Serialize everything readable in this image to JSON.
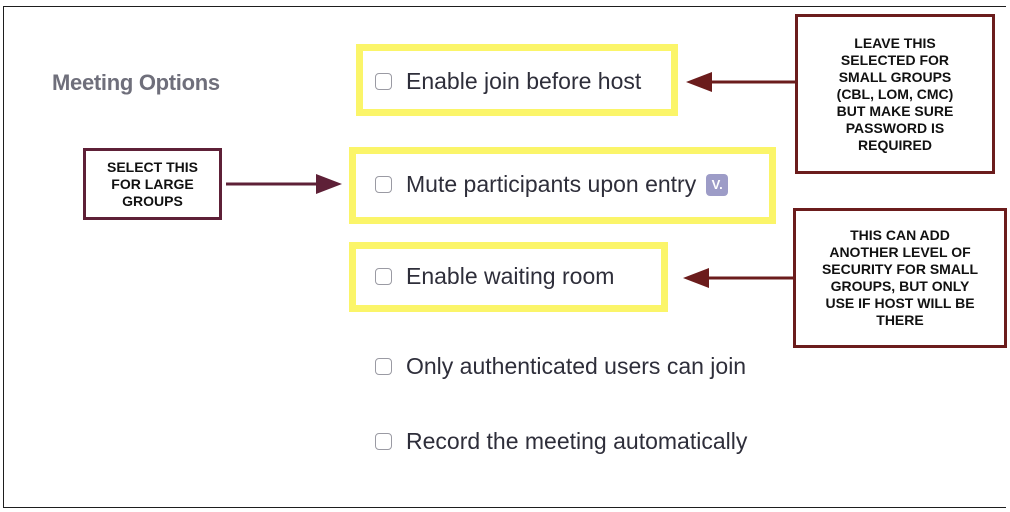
{
  "section": {
    "label": "Meeting Options"
  },
  "options": [
    {
      "label": "Enable join before host",
      "checked": false
    },
    {
      "label": "Mute participants upon entry",
      "checked": false,
      "icon": "info-icon",
      "icon_text": "V."
    },
    {
      "label": "Enable waiting room",
      "checked": false
    },
    {
      "label": "Only authenticated users can join",
      "checked": false
    },
    {
      "label": "Record the meeting automatically",
      "checked": false
    }
  ],
  "callouts": {
    "join_before_host": "LEAVE THIS\nSELECTED FOR\nSMALL GROUPS\n(CBL, LOM, CMC)\nBUT MAKE SURE\nPASSWORD IS\nREQUIRED",
    "mute_participants": "SELECT THIS\nFOR LARGE\nGROUPS",
    "waiting_room": "THIS CAN ADD\nANOTHER LEVEL OF\nSECURITY FOR SMALL\nGROUPS, BUT ONLY\nUSE IF HOST WILL BE\nTHERE"
  },
  "colors": {
    "highlight": "#fbf569",
    "callout_border": "#6b1c1c",
    "arrow": "#6b1c1c",
    "arrow_left": "#5e2037",
    "label_gray": "#6f6f7b",
    "info_icon": "#9d9cc7"
  }
}
